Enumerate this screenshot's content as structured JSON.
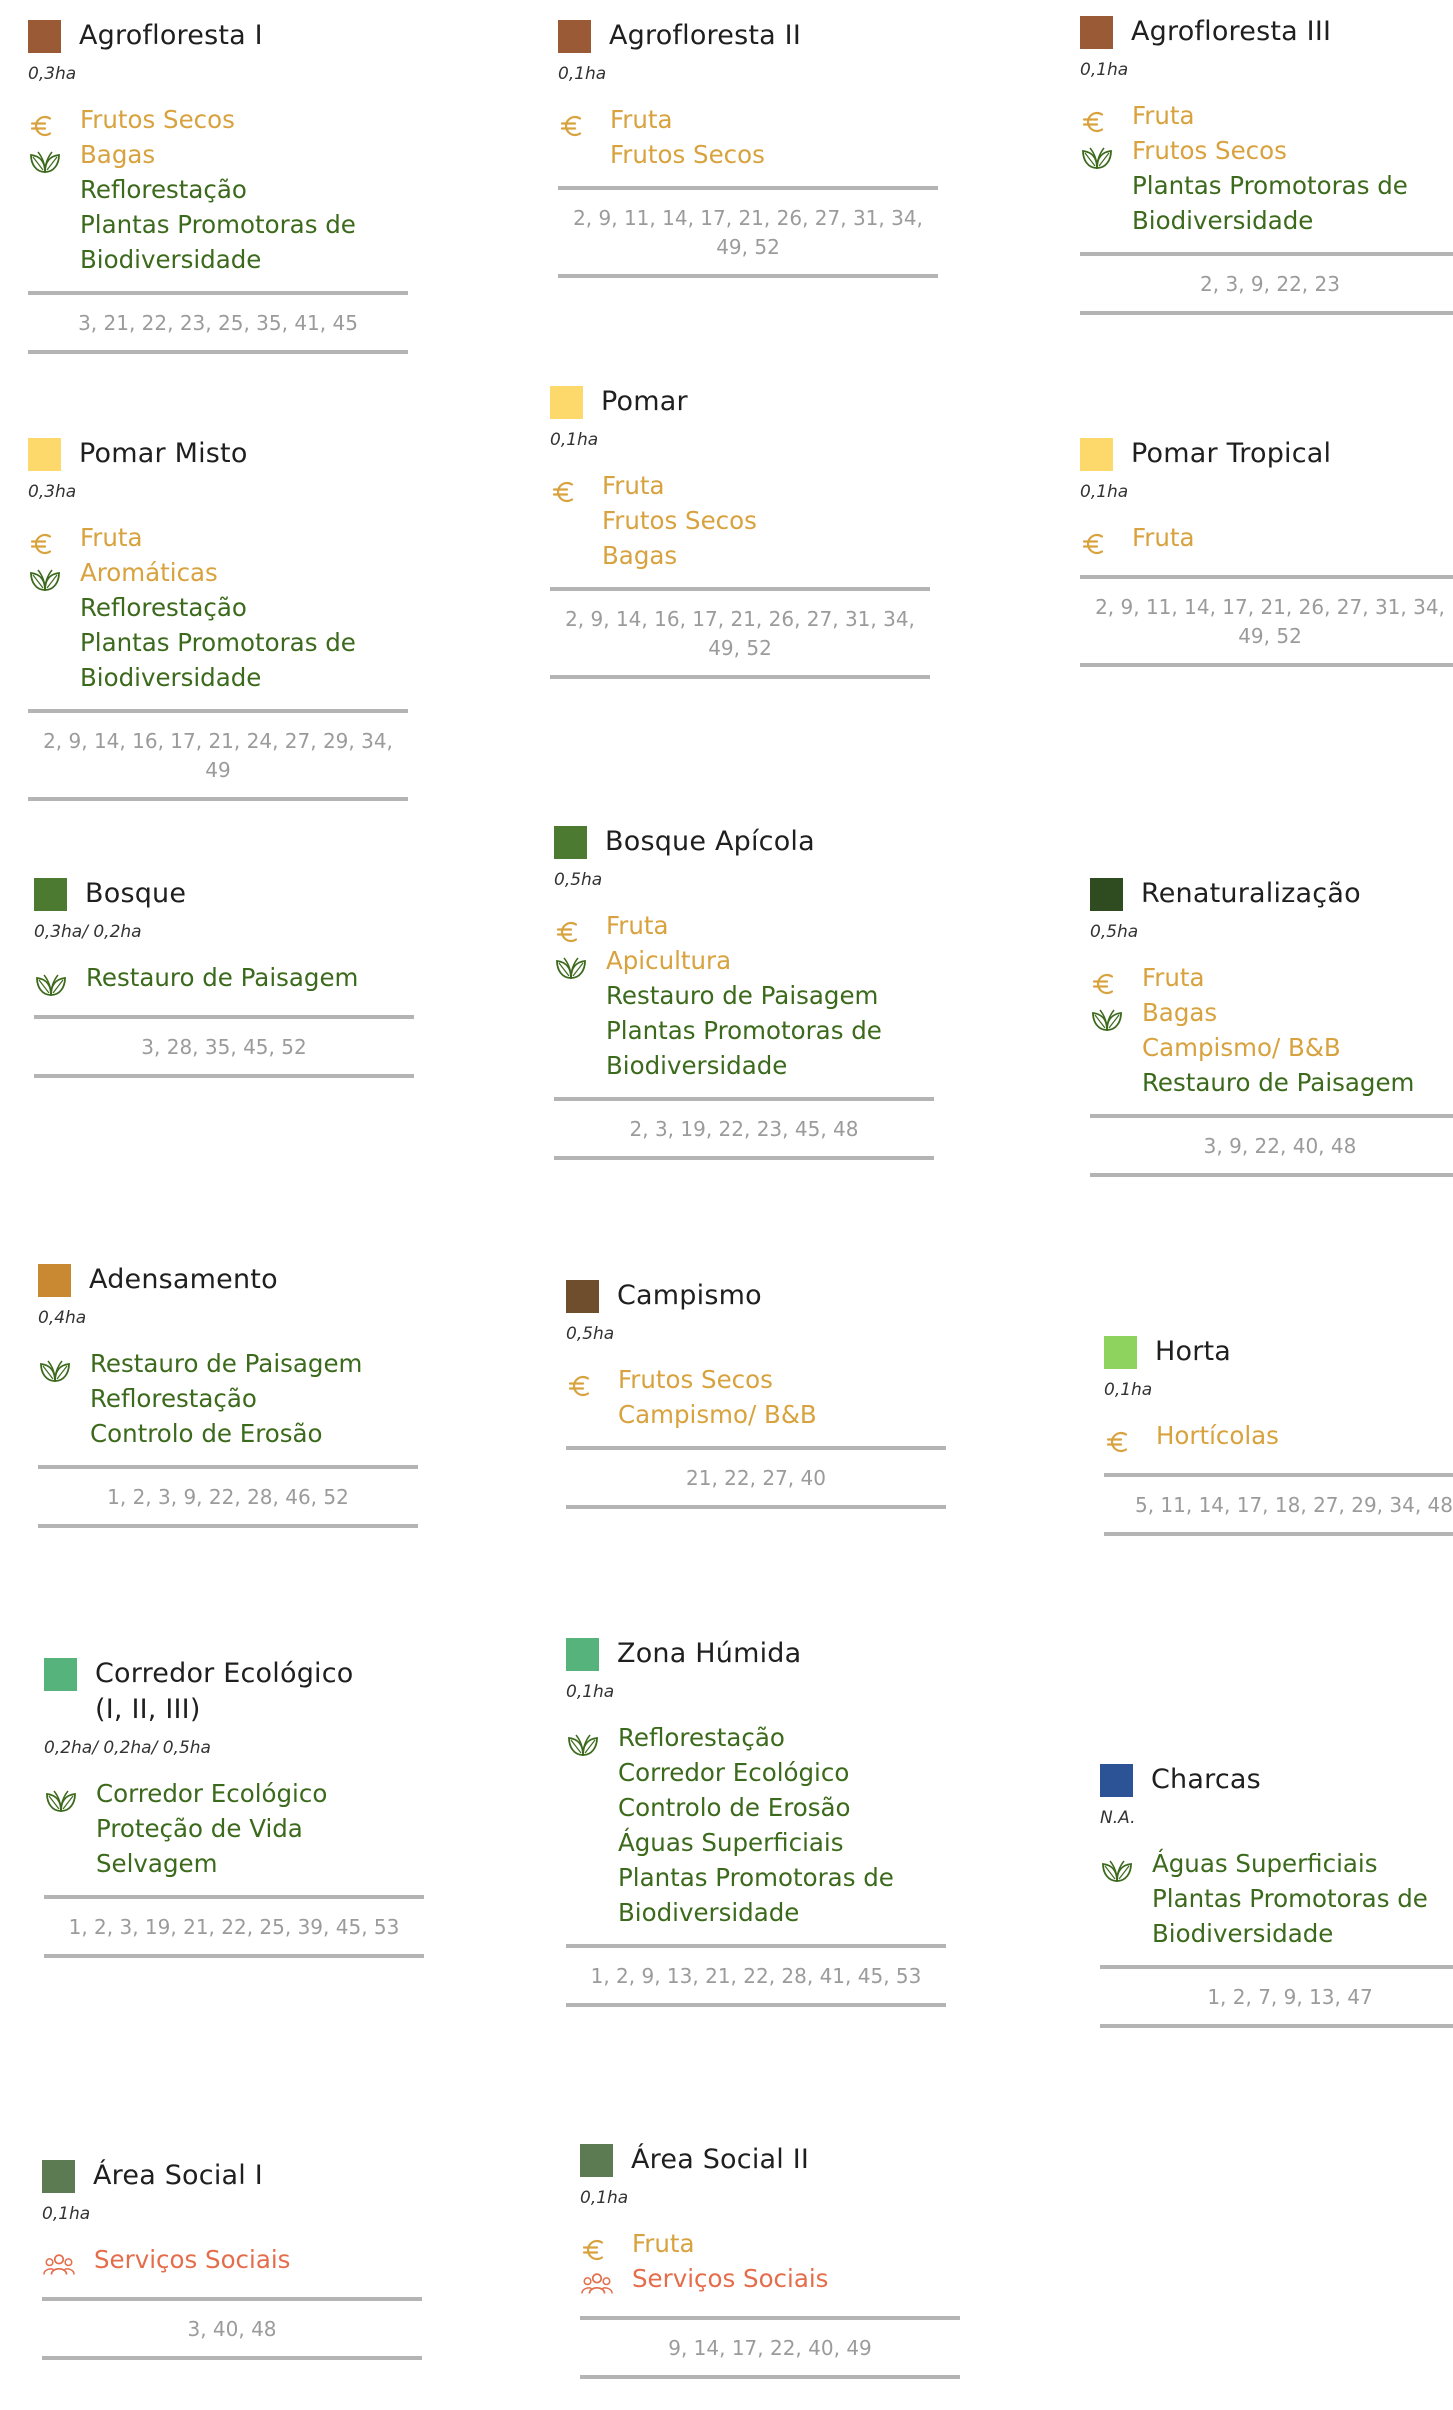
{
  "legend_colors": {
    "economic": "#d8a23e",
    "environmental": "#3c6a1c",
    "social": "#e46d4c"
  },
  "cards": [
    {
      "title": "Agrofloresta I",
      "color": "#9b5a36",
      "area": "0,3ha",
      "icons": [
        "euro-icon",
        "leaf-icon"
      ],
      "items": [
        {
          "text": "Frutos Secos",
          "type": "eco"
        },
        {
          "text": "Bagas",
          "type": "eco"
        },
        {
          "text": "Reflorestação",
          "type": "env"
        },
        {
          "text": "Plantas Promotoras de",
          "type": "env"
        },
        {
          "text": "Biodiversidade",
          "type": "env"
        }
      ],
      "refs": "3, 21, 22, 23, 25, 35, 41, 45"
    },
    {
      "title": "Agrofloresta II",
      "color": "#9b5a36",
      "area": "0,1ha",
      "icons": [
        "euro-icon"
      ],
      "items": [
        {
          "text": "Fruta",
          "type": "eco"
        },
        {
          "text": "Frutos Secos",
          "type": "eco"
        }
      ],
      "refs": "2, 9, 11, 14, 17, 21, 26, 27, 31, 34, 49, 52"
    },
    {
      "title": "Agrofloresta III",
      "color": "#9b5a36",
      "area": "0,1ha",
      "icons": [
        "euro-icon",
        "leaf-icon"
      ],
      "items": [
        {
          "text": "Fruta",
          "type": "eco"
        },
        {
          "text": "Frutos Secos",
          "type": "eco"
        },
        {
          "text": "Plantas Promotoras de",
          "type": "env"
        },
        {
          "text": "Biodiversidade",
          "type": "env"
        }
      ],
      "refs": "2, 3, 9, 22, 23"
    },
    {
      "title": "Pomar Misto",
      "color": "#fdd86a",
      "area": "0,3ha",
      "icons": [
        "euro-icon",
        "leaf-icon"
      ],
      "items": [
        {
          "text": "Fruta",
          "type": "eco"
        },
        {
          "text": "Aromáticas",
          "type": "eco"
        },
        {
          "text": "Reflorestação",
          "type": "env"
        },
        {
          "text": "Plantas Promotoras de",
          "type": "env"
        },
        {
          "text": "Biodiversidade",
          "type": "env"
        }
      ],
      "refs": "2, 9, 14, 16, 17, 21, 24, 27, 29, 34, 49"
    },
    {
      "title": "Pomar",
      "color": "#fdd86a",
      "area": "0,1ha",
      "icons": [
        "euro-icon"
      ],
      "items": [
        {
          "text": "Fruta",
          "type": "eco"
        },
        {
          "text": "Frutos Secos",
          "type": "eco"
        },
        {
          "text": "Bagas",
          "type": "eco"
        }
      ],
      "refs": "2, 9, 14, 16, 17, 21, 26, 27, 31, 34, 49, 52"
    },
    {
      "title": "Pomar Tropical",
      "color": "#fdd86a",
      "area": "0,1ha",
      "icons": [
        "euro-icon"
      ],
      "items": [
        {
          "text": "Fruta",
          "type": "eco"
        }
      ],
      "refs": "2, 9, 11, 14, 17, 21, 26, 27, 31, 34, 49, 52"
    },
    {
      "title": "Bosque",
      "color": "#4b7a30",
      "area": "0,3ha/ 0,2ha",
      "icons": [
        "leaf-icon"
      ],
      "items": [
        {
          "text": "Restauro de Paisagem",
          "type": "env"
        }
      ],
      "refs": "3, 28, 35, 45, 52"
    },
    {
      "title": "Bosque Apícola",
      "color": "#4b7a30",
      "area": "0,5ha",
      "icons": [
        "euro-icon",
        "leaf-icon"
      ],
      "items": [
        {
          "text": "Fruta",
          "type": "eco"
        },
        {
          "text": "Apicultura",
          "type": "eco"
        },
        {
          "text": "Restauro de Paisagem",
          "type": "env"
        },
        {
          "text": "Plantas Promotoras de",
          "type": "env"
        },
        {
          "text": "Biodiversidade",
          "type": "env"
        }
      ],
      "refs": "2, 3, 19, 22, 23, 45, 48"
    },
    {
      "title": "Renaturalização",
      "color": "#2f4c20",
      "area": "0,5ha",
      "icons": [
        "euro-icon",
        "leaf-icon"
      ],
      "items": [
        {
          "text": "Fruta",
          "type": "eco"
        },
        {
          "text": "Bagas",
          "type": "eco"
        },
        {
          "text": "Campismo/ B&B",
          "type": "eco"
        },
        {
          "text": "Restauro de Paisagem",
          "type": "env"
        }
      ],
      "refs": "3, 9, 22, 40, 48"
    },
    {
      "title": "Adensamento",
      "color": "#c98933",
      "area": "0,4ha",
      "icons": [
        "leaf-icon"
      ],
      "items": [
        {
          "text": "Restauro de Paisagem",
          "type": "env"
        },
        {
          "text": "Reflorestação",
          "type": "env"
        },
        {
          "text": "Controlo de Erosão",
          "type": "env"
        }
      ],
      "refs": "1, 2, 3, 9, 22, 28, 46, 52"
    },
    {
      "title": "Campismo",
      "color": "#6e4e2c",
      "area": "0,5ha",
      "icons": [
        "euro-icon"
      ],
      "items": [
        {
          "text": "Frutos Secos",
          "type": "eco"
        },
        {
          "text": "Campismo/ B&B",
          "type": "eco"
        }
      ],
      "refs": "21, 22, 27, 40"
    },
    {
      "title": "Horta",
      "color": "#8ed35e",
      "area": "0,1ha",
      "icons": [
        "euro-icon"
      ],
      "items": [
        {
          "text": "Hortícolas",
          "type": "eco"
        }
      ],
      "refs": "5, 11, 14, 17, 18, 27, 29, 34, 48"
    },
    {
      "title": "Corredor Ecológico\n(I, II, III)",
      "color": "#56b37c",
      "area": "0,2ha/ 0,2ha/ 0,5ha",
      "icons": [
        "leaf-icon"
      ],
      "items": [
        {
          "text": "Corredor Ecológico",
          "type": "env"
        },
        {
          "text": "Proteção de Vida",
          "type": "env"
        },
        {
          "text": "Selvagem",
          "type": "env"
        }
      ],
      "refs": "1, 2, 3, 19, 21, 22, 25, 39, 45, 53"
    },
    {
      "title": "Zona Húmida",
      "color": "#56b37c",
      "area": "0,1ha",
      "icons": [
        "leaf-icon"
      ],
      "items": [
        {
          "text": "Reflorestação",
          "type": "env"
        },
        {
          "text": "Corredor Ecológico",
          "type": "env"
        },
        {
          "text": "Controlo de Erosão",
          "type": "env"
        },
        {
          "text": "Águas Superficiais",
          "type": "env"
        },
        {
          "text": "Plantas Promotoras de",
          "type": "env"
        },
        {
          "text": "Biodiversidade",
          "type": "env"
        }
      ],
      "refs": "1, 2, 9, 13, 21, 22, 28, 41, 45, 53"
    },
    {
      "title": "Charcas",
      "color": "#2c5396",
      "area": "N.A.",
      "icons": [
        "leaf-icon"
      ],
      "items": [
        {
          "text": "Águas Superficiais",
          "type": "env"
        },
        {
          "text": "Plantas Promotoras de",
          "type": "env"
        },
        {
          "text": "Biodiversidade",
          "type": "env"
        }
      ],
      "refs": "1, 2, 7, 9, 13, 47"
    },
    {
      "title": "Área Social I",
      "color": "#5c7b52",
      "area": "0,1ha",
      "icons": [
        "people-icon"
      ],
      "items": [
        {
          "text": "Serviços Sociais",
          "type": "soc"
        }
      ],
      "refs": "3, 40, 48"
    },
    {
      "title": "Área Social II",
      "color": "#5c7b52",
      "area": "0,1ha",
      "icons": [
        "euro-icon",
        "people-icon"
      ],
      "items": [
        {
          "text": "Fruta",
          "type": "eco"
        },
        {
          "text": "Serviços Sociais",
          "type": "soc"
        }
      ],
      "refs": "9, 14, 17, 22, 40, 49"
    }
  ]
}
